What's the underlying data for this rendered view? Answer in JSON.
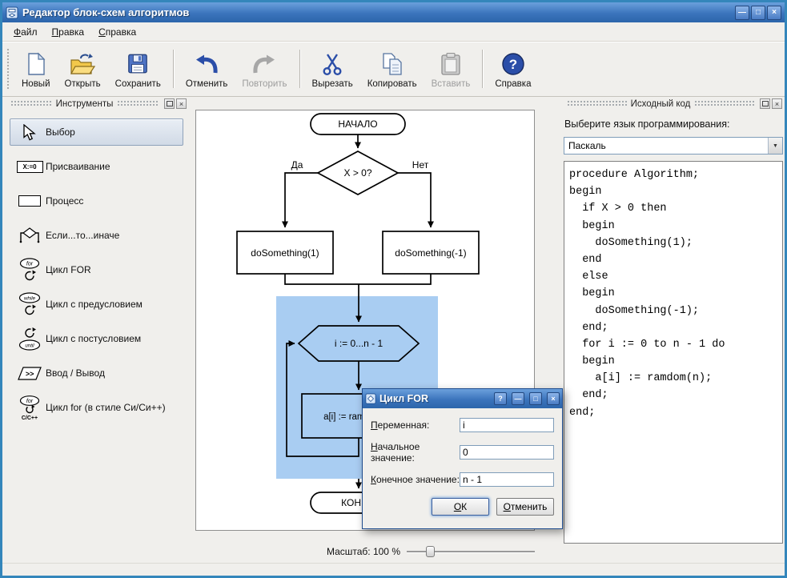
{
  "window": {
    "title": "Редактор блок-схем алгоритмов"
  },
  "glyphs": {
    "minimize": "—",
    "maximize": "□",
    "close": "×",
    "help": "?",
    "combo_arrow": "▼"
  },
  "colors": {
    "titlebar_blue": "#3b74bc",
    "selection_blue": "#a9cdf2",
    "frame_blue": "#3486bb"
  },
  "menu": {
    "file": "Файл",
    "edit": "Правка",
    "help": "Справка"
  },
  "toolbar": {
    "new": "Новый",
    "open": "Открыть",
    "save": "Сохранить",
    "undo": "Отменить",
    "redo": "Повторить",
    "cut": "Вырезать",
    "copy": "Копировать",
    "paste": "Вставить",
    "help": "Справка"
  },
  "tools": {
    "title": "Инструменты",
    "items": [
      {
        "label": "Выбор",
        "icon": "cursor-icon",
        "selected": true
      },
      {
        "label": "Присваивание",
        "icon": "assignment-icon",
        "glyph": "X:=0"
      },
      {
        "label": "Процесс",
        "icon": "process-icon"
      },
      {
        "label": "Если...то...иначе",
        "icon": "if-else-icon"
      },
      {
        "label": "Цикл FOR",
        "icon": "for-loop-icon",
        "glyph": "for"
      },
      {
        "label": "Цикл с предусловием",
        "icon": "while-loop-icon",
        "glyph": "while"
      },
      {
        "label": "Цикл с постусловием",
        "icon": "until-loop-icon",
        "glyph": "until"
      },
      {
        "label": "Ввод / Вывод",
        "icon": "io-icon",
        "glyph": ">>"
      },
      {
        "label": "Цикл for (в стиле Си/Си++)",
        "icon": "c-for-loop-icon",
        "glyph": "for",
        "glyph2": "C/C++"
      }
    ]
  },
  "canvas": {
    "zoom_label": "Масштаб: 100 %",
    "flowchart": {
      "start": "НАЧАЛО",
      "condition": "X > 0?",
      "branch_yes": "Да",
      "branch_no": "Нет",
      "then_block": "doSomething(1)",
      "else_block": "doSomething(-1)",
      "loop_header": "i := 0...n - 1",
      "loop_body": "a[i] := ramdom(n)",
      "end": "КОНЕЦ"
    }
  },
  "source": {
    "title": "Исходный код",
    "language_label": "Выберите язык программирования:",
    "language": "Паскаль",
    "code": "procedure Algorithm;\nbegin\n  if X > 0 then\n  begin\n    doSomething(1);\n  end\n  else\n  begin\n    doSomething(-1);\n  end;\n  for i := 0 to n - 1 do\n  begin\n    a[i] := ramdom(n);\n  end;\nend;"
  },
  "dialog": {
    "title": "Цикл FOR",
    "fields": [
      {
        "label": "Переменная:",
        "value": "i"
      },
      {
        "label": "Начальное значение:",
        "value": "0"
      },
      {
        "label": "Конечное значение:",
        "value": "n - 1"
      }
    ],
    "ok": "ОК",
    "cancel": "Отменить"
  }
}
